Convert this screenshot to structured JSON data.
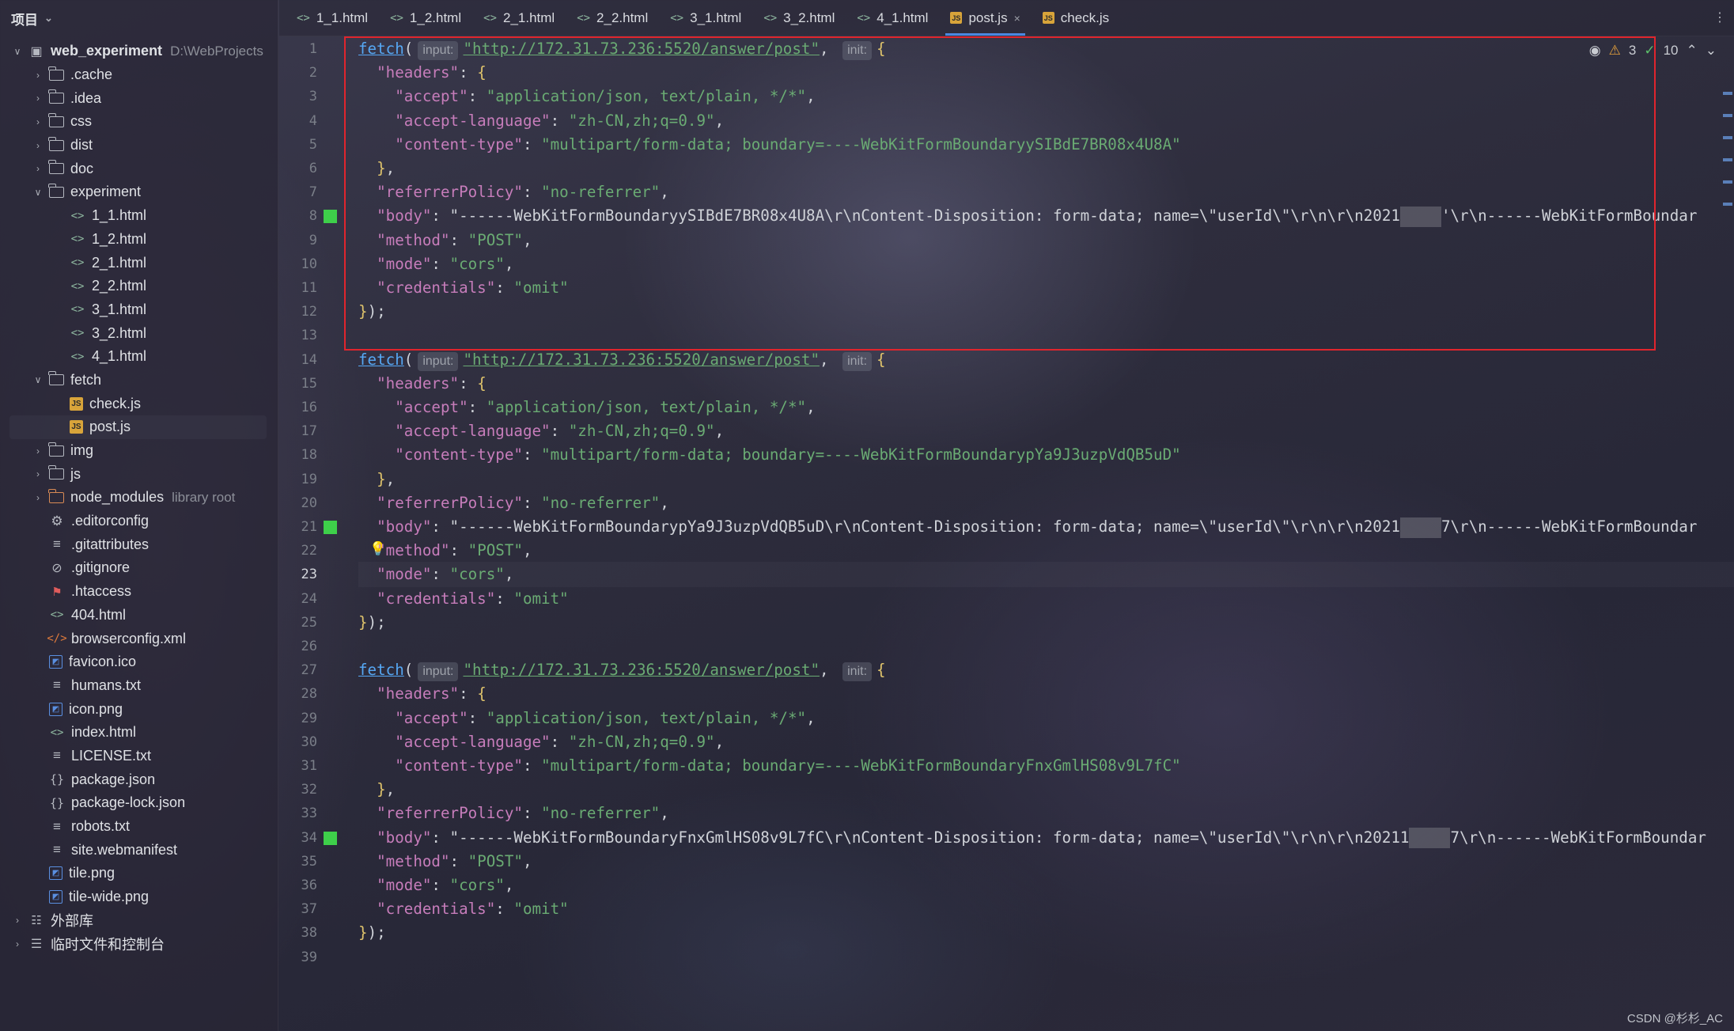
{
  "project": {
    "header_label": "项目"
  },
  "tree": [
    {
      "depth": 0,
      "arrow": "open",
      "icon": "module",
      "label": "web_experiment",
      "extra": "D:\\WebProjects",
      "bold": true
    },
    {
      "depth": 1,
      "arrow": "closed",
      "icon": "folder",
      "label": ".cache"
    },
    {
      "depth": 1,
      "arrow": "closed",
      "icon": "folder",
      "label": ".idea"
    },
    {
      "depth": 1,
      "arrow": "closed",
      "icon": "folder",
      "label": "css"
    },
    {
      "depth": 1,
      "arrow": "closed",
      "icon": "folder",
      "label": "dist"
    },
    {
      "depth": 1,
      "arrow": "closed",
      "icon": "folder",
      "label": "doc"
    },
    {
      "depth": 1,
      "arrow": "open",
      "icon": "folder",
      "label": "experiment"
    },
    {
      "depth": 2,
      "arrow": "none",
      "icon": "html",
      "label": "1_1.html"
    },
    {
      "depth": 2,
      "arrow": "none",
      "icon": "html",
      "label": "1_2.html"
    },
    {
      "depth": 2,
      "arrow": "none",
      "icon": "html",
      "label": "2_1.html"
    },
    {
      "depth": 2,
      "arrow": "none",
      "icon": "html",
      "label": "2_2.html"
    },
    {
      "depth": 2,
      "arrow": "none",
      "icon": "html",
      "label": "3_1.html"
    },
    {
      "depth": 2,
      "arrow": "none",
      "icon": "html",
      "label": "3_2.html"
    },
    {
      "depth": 2,
      "arrow": "none",
      "icon": "html",
      "label": "4_1.html"
    },
    {
      "depth": 1,
      "arrow": "open",
      "icon": "folder",
      "label": "fetch"
    },
    {
      "depth": 2,
      "arrow": "none",
      "icon": "js",
      "label": "check.js"
    },
    {
      "depth": 2,
      "arrow": "none",
      "icon": "js",
      "label": "post.js",
      "selected": true
    },
    {
      "depth": 1,
      "arrow": "closed",
      "icon": "folder",
      "label": "img"
    },
    {
      "depth": 1,
      "arrow": "closed",
      "icon": "folder",
      "label": "js"
    },
    {
      "depth": 1,
      "arrow": "closed",
      "icon": "folder-orange",
      "label": "node_modules",
      "extra": "library root"
    },
    {
      "depth": 1,
      "arrow": "none",
      "icon": "gear",
      "label": ".editorconfig"
    },
    {
      "depth": 1,
      "arrow": "none",
      "icon": "lines",
      "label": ".gitattributes"
    },
    {
      "depth": 1,
      "arrow": "none",
      "icon": "ban",
      "label": ".gitignore"
    },
    {
      "depth": 1,
      "arrow": "none",
      "icon": "ht",
      "label": ".htaccess"
    },
    {
      "depth": 1,
      "arrow": "none",
      "icon": "html",
      "label": "404.html"
    },
    {
      "depth": 1,
      "arrow": "none",
      "icon": "xml",
      "label": "browserconfig.xml"
    },
    {
      "depth": 1,
      "arrow": "none",
      "icon": "img",
      "label": "favicon.ico"
    },
    {
      "depth": 1,
      "arrow": "none",
      "icon": "lines",
      "label": "humans.txt"
    },
    {
      "depth": 1,
      "arrow": "none",
      "icon": "img",
      "label": "icon.png"
    },
    {
      "depth": 1,
      "arrow": "none",
      "icon": "html",
      "label": "index.html"
    },
    {
      "depth": 1,
      "arrow": "none",
      "icon": "lines",
      "label": "LICENSE.txt"
    },
    {
      "depth": 1,
      "arrow": "none",
      "icon": "json",
      "label": "package.json"
    },
    {
      "depth": 1,
      "arrow": "none",
      "icon": "json",
      "label": "package-lock.json"
    },
    {
      "depth": 1,
      "arrow": "none",
      "icon": "lines",
      "label": "robots.txt"
    },
    {
      "depth": 1,
      "arrow": "none",
      "icon": "lines",
      "label": "site.webmanifest"
    },
    {
      "depth": 1,
      "arrow": "none",
      "icon": "img",
      "label": "tile.png"
    },
    {
      "depth": 1,
      "arrow": "none",
      "icon": "img",
      "label": "tile-wide.png"
    },
    {
      "depth": 0,
      "arrow": "closed",
      "icon": "lib",
      "label": "外部库"
    },
    {
      "depth": 0,
      "arrow": "closed",
      "icon": "console",
      "label": "临时文件和控制台"
    }
  ],
  "tabs": [
    {
      "label": "1_1.html",
      "icon": "html"
    },
    {
      "label": "1_2.html",
      "icon": "html"
    },
    {
      "label": "2_1.html",
      "icon": "html"
    },
    {
      "label": "2_2.html",
      "icon": "html"
    },
    {
      "label": "3_1.html",
      "icon": "html"
    },
    {
      "label": "3_2.html",
      "icon": "html"
    },
    {
      "label": "4_1.html",
      "icon": "html"
    },
    {
      "label": "post.js",
      "icon": "js",
      "active": true,
      "closable": true
    },
    {
      "label": "check.js",
      "icon": "js"
    }
  ],
  "inspection": {
    "warnings": "3",
    "ok": "10"
  },
  "editor": {
    "current_line": 23,
    "changed_lines": [
      8,
      21,
      34
    ],
    "bulb_line": 22,
    "hint_input": "input:",
    "hint_init": "init:",
    "requests": [
      {
        "url": "\"http://172.31.73.236:5520/answer/post\"",
        "boundary": "\"multipart/form-data; boundary=----WebKitFormBoundaryySIBdE7BR08x4U8A\"",
        "body_start": "\"------WebKitFormBoundaryySIBdE7BR08x4U8A\\r\\nContent-Disposition: form-data; name=\\\"userId\\\"\\r\\n\\r\\n2021",
        "body_end": "'\\r\\n------WebKitFormBoundar"
      },
      {
        "url": "\"http://172.31.73.236:5520/answer/post\"",
        "boundary": "\"multipart/form-data; boundary=----WebKitFormBoundarypYa9J3uzpVdQB5uD\"",
        "body_start": "\"------WebKitFormBoundarypYa9J3uzpVdQB5uD\\r\\nContent-Disposition: form-data; name=\\\"userId\\\"\\r\\n\\r\\n2021",
        "body_end": "7\\r\\n------WebKitFormBoundar"
      },
      {
        "url": "\"http://172.31.73.236:5520/answer/post\"",
        "boundary": "\"multipart/form-data; boundary=----WebKitFormBoundaryFnxGmlHS08v9L7fC\"",
        "body_start": "\"------WebKitFormBoundaryFnxGmlHS08v9L7fC\\r\\nContent-Disposition: form-data; name=\\\"userId\\\"\\r\\n\\r\\n20211",
        "body_end": "7\\r\\n------WebKitFormBoundar"
      }
    ],
    "accept": "\"application/json, text/plain, */*\"",
    "accept_language": "\"zh-CN,zh;q=0.9\"",
    "referrer_policy": "\"no-referrer\"",
    "method": "\"POST\"",
    "mode": "\"cors\"",
    "credentials": "\"omit\"",
    "total_lines": 39
  },
  "watermark": "CSDN @杉杉_AC"
}
